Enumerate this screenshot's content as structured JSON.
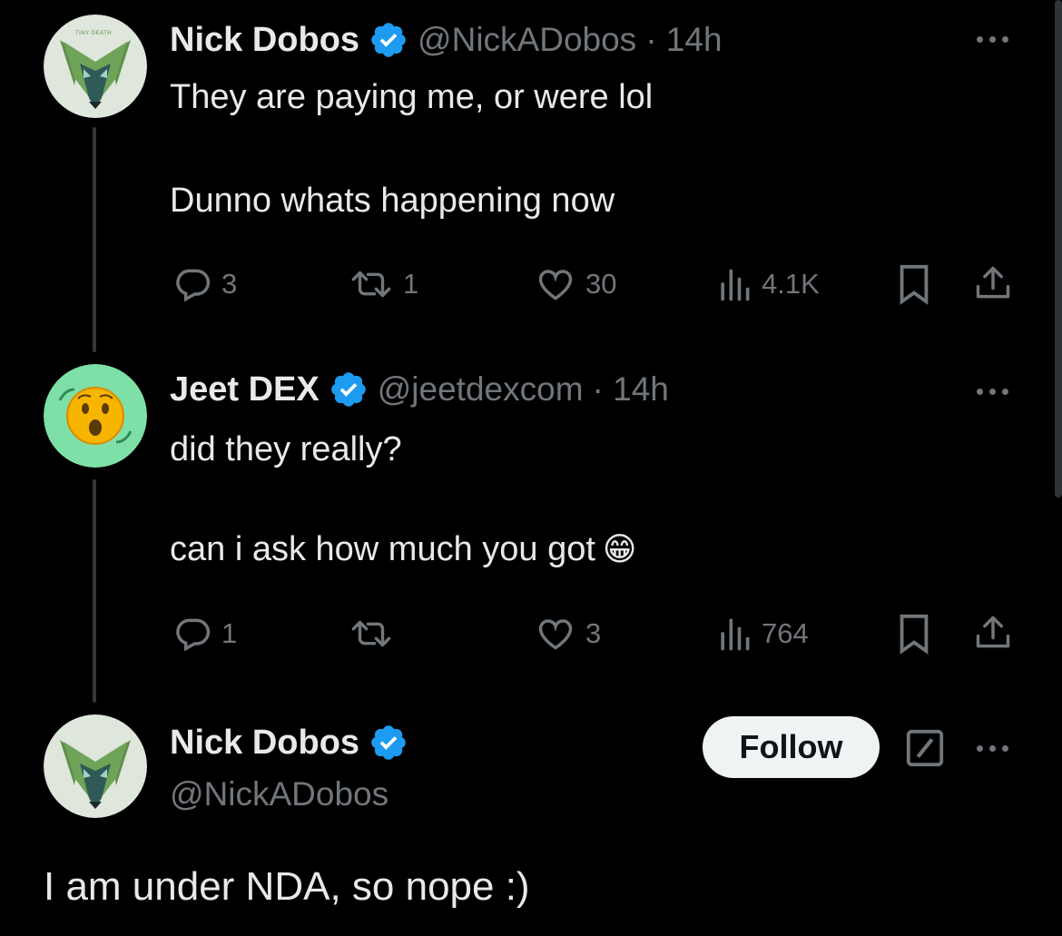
{
  "tweets": [
    {
      "name": "Nick Dobos",
      "handle": "@NickADobos",
      "time": "· 14h",
      "lines": [
        "They are paying me, or were lol",
        "Dunno whats happening now"
      ],
      "replies": "3",
      "reposts": "1",
      "likes": "30",
      "views": "4.1K",
      "avatar_icon": "fox-avatar-icon"
    },
    {
      "name": "Jeet DEX",
      "handle": "@jeetdexcom",
      "time": "· 14h",
      "lines": [
        "did they really?",
        "can i ask how much you got"
      ],
      "emoji": "😁",
      "replies": "1",
      "reposts": "",
      "likes": "3",
      "views": "764",
      "avatar_icon": "surprised-face-avatar-icon"
    }
  ],
  "main_post": {
    "name": "Nick Dobos",
    "handle": "@NickADobos",
    "text": "I am under NDA, so nope :)",
    "follow_label": "Follow",
    "avatar_logo_text": "TINY DEATH"
  },
  "colors": {
    "background": "#000000",
    "text": "#e7e9ea",
    "muted": "#71767b",
    "verified": "#1d9bf0",
    "avatar_green": "#7ee0a6"
  }
}
